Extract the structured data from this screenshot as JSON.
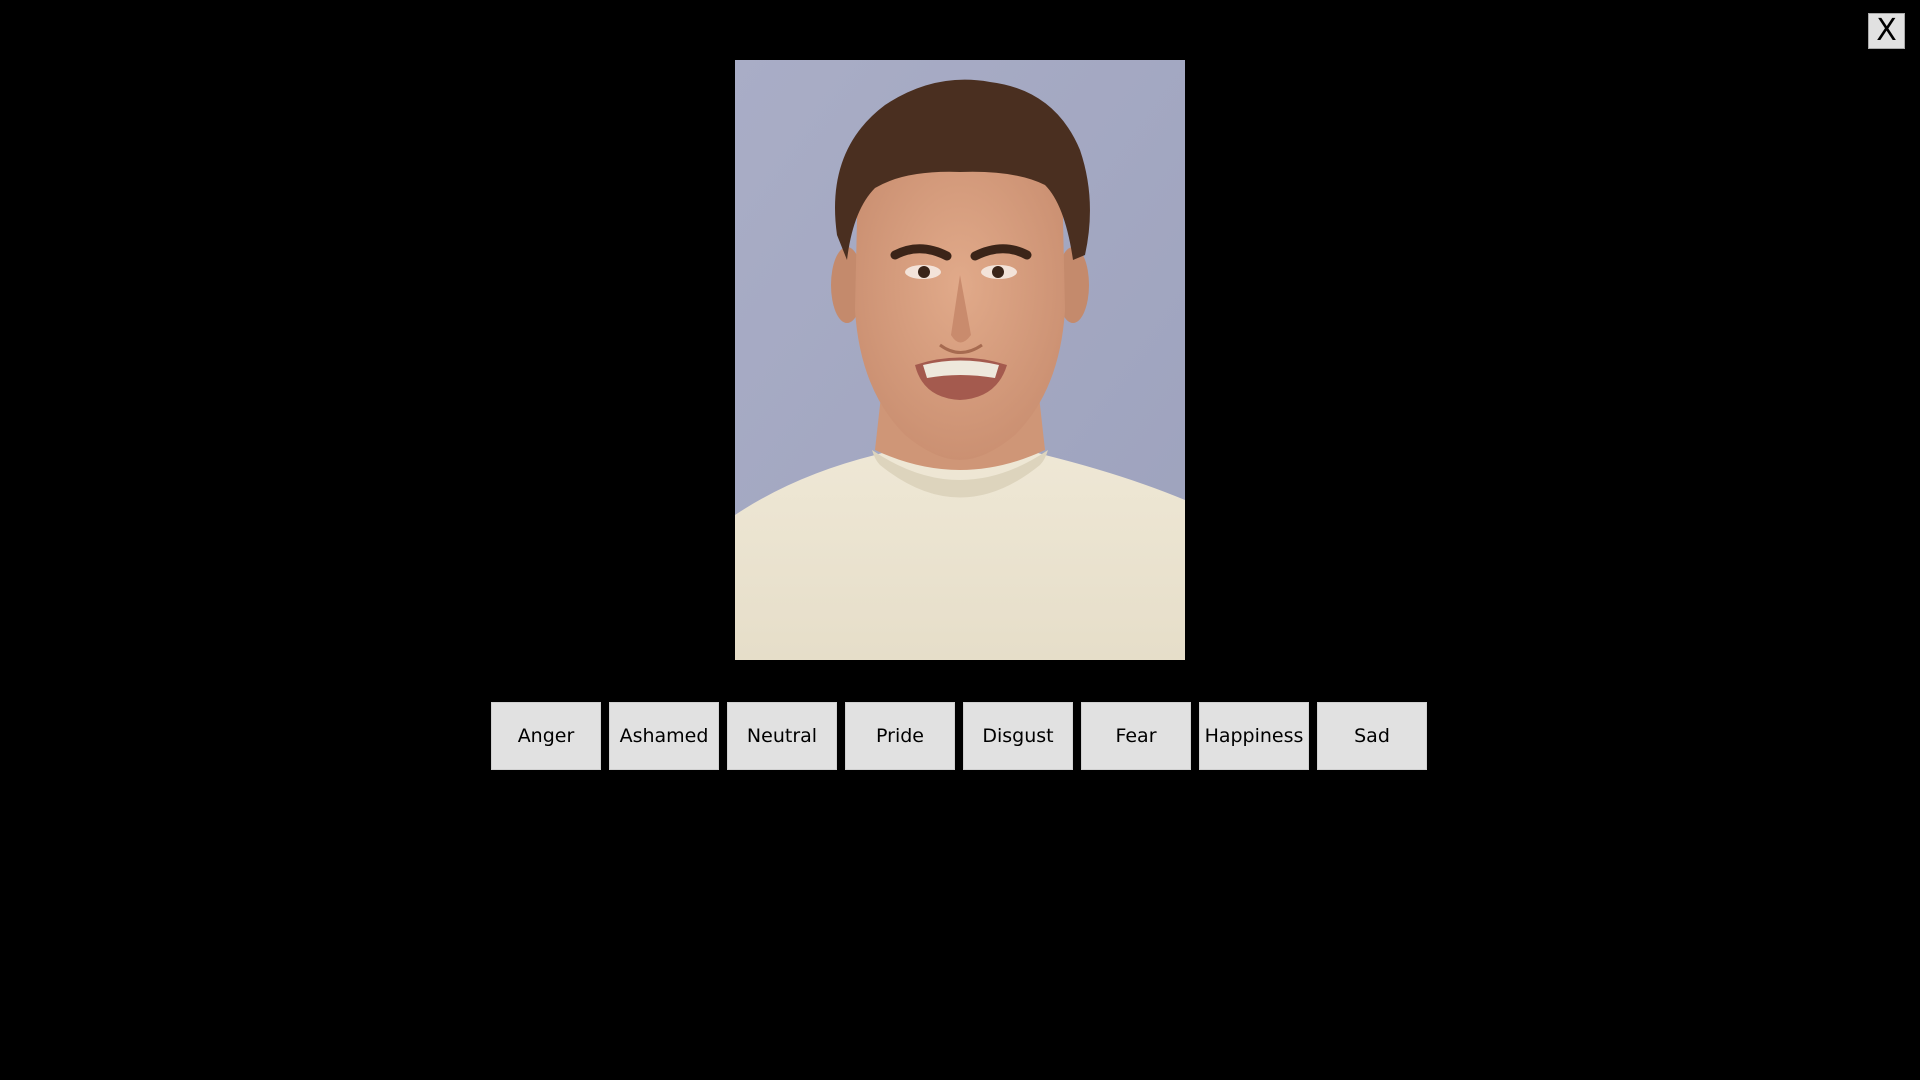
{
  "window": {
    "close_label": "X"
  },
  "stimulus": {
    "image_icon": "face-photo"
  },
  "choices": [
    {
      "label": "Anger"
    },
    {
      "label": "Ashamed"
    },
    {
      "label": "Neutral"
    },
    {
      "label": "Pride"
    },
    {
      "label": "Disgust"
    },
    {
      "label": "Fear"
    },
    {
      "label": "Happiness"
    },
    {
      "label": "Sad"
    }
  ],
  "colors": {
    "background": "#000000",
    "button_face": "#e1e1e1",
    "photo_backdrop": "#a3a8c3",
    "shirt": "#ece5d2"
  }
}
